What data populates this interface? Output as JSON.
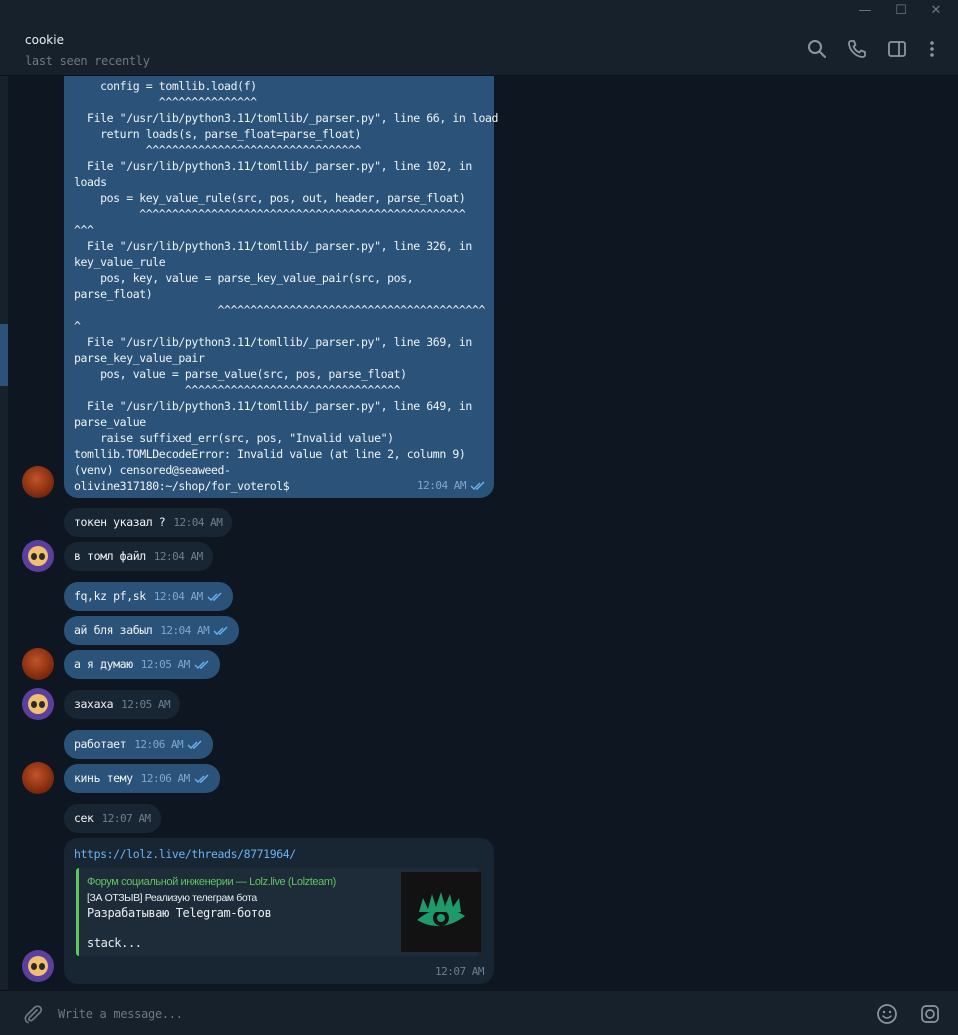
{
  "window": {
    "minimize": "—",
    "maximize": "☐",
    "close": "✕"
  },
  "header": {
    "name": "cookie",
    "status": "last seen recently"
  },
  "traceback": {
    "lines": [
      "    config = tomllib.load(f)",
      "             ^^^^^^^^^^^^^^^",
      "  File \"/usr/lib/python3.11/tomllib/_parser.py\", line 66, in load",
      "    return loads(s, parse_float=parse_float)",
      "           ^^^^^^^^^^^^^^^^^^^^^^^^^^^^^^^^^",
      "  File \"/usr/lib/python3.11/tomllib/_parser.py\", line 102, in",
      "loads",
      "    pos = key_value_rule(src, pos, out, header, parse_float)",
      "          ^^^^^^^^^^^^^^^^^^^^^^^^^^^^^^^^^^^^^^^^^^^^^^^^^^",
      "^^^",
      "  File \"/usr/lib/python3.11/tomllib/_parser.py\", line 326, in",
      "key_value_rule",
      "    pos, key, value = parse_key_value_pair(src, pos,",
      "parse_float)",
      "                      ^^^^^^^^^^^^^^^^^^^^^^^^^^^^^^^^^^^^^^^^^",
      "^",
      "  File \"/usr/lib/python3.11/tomllib/_parser.py\", line 369, in",
      "parse_key_value_pair",
      "    pos, value = parse_value(src, pos, parse_float)",
      "                 ^^^^^^^^^^^^^^^^^^^^^^^^^^^^^^^^^",
      "  File \"/usr/lib/python3.11/tomllib/_parser.py\", line 649, in",
      "parse_value",
      "    raise suffixed_err(src, pos, \"Invalid value\")",
      "tomllib.TOMLDecodeError: Invalid value (at line 2, column 9)",
      "(venv) censored@seaweed-",
      "olivine317180:~/shop/for_voterol$"
    ],
    "time": "12:04 AM"
  },
  "messages": [
    {
      "text": "токен указал ?",
      "time": "12:04 AM"
    },
    {
      "text": "в томл файл",
      "time": "12:04 AM"
    },
    {
      "text": "fq,kz pf,sk",
      "time": "12:04 AM"
    },
    {
      "text": "ай бля забыл",
      "time": "12:04 AM"
    },
    {
      "text": "а я думаю",
      "time": "12:05 AM"
    },
    {
      "text": "захаха",
      "time": "12:05 AM"
    },
    {
      "text": "работает",
      "time": "12:06 AM"
    },
    {
      "text": "кинь тему",
      "time": "12:06 AM"
    },
    {
      "text": "сек",
      "time": "12:07 AM"
    }
  ],
  "link_message": {
    "url": "https://lolz.live/threads/8771964/",
    "time": "12:07 AM",
    "preview": {
      "site": "Форум социальной инженерии —  Lolz.live (Lolzteam)",
      "title": "[ЗА ОТЗЫВ] Реализую телеграм бота",
      "desc1": "Разрабатываю Telegram-ботов",
      "desc2": "stack..."
    }
  },
  "composer": {
    "placeholder": "Write a message..."
  },
  "colors": {
    "outgoing": "#2b5278",
    "incoming": "#182533",
    "background": "#0e1621",
    "link": "#6ab3f3",
    "preview_accent": "#5ec45e"
  }
}
